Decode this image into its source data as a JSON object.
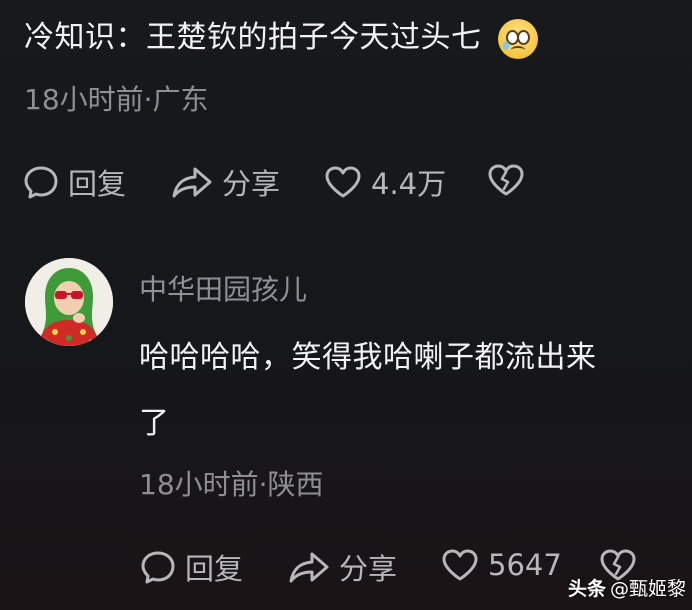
{
  "top_comment": {
    "text": "冷知识：王楚钦的拍子今天过头七",
    "emoji": "crying-face-emoji",
    "meta": "18小时前·广东",
    "actions": {
      "reply_label": "回复",
      "share_label": "分享",
      "like_count": "4.4万"
    }
  },
  "reply_comment": {
    "username": "中华田园孩儿",
    "text_line1": "哈哈哈哈，笑得我哈喇子都流出来",
    "text_line2": "了",
    "meta": "18小时前·陕西",
    "actions": {
      "reply_label": "回复",
      "share_label": "分享",
      "like_count": "5647"
    }
  },
  "watermark": {
    "platform": "头条",
    "author": "@甄姬黎"
  },
  "colors": {
    "background": "#16181c",
    "text_primary": "#f2f2f2",
    "text_secondary": "#8d8f93",
    "action_text": "#b5b7ba"
  }
}
